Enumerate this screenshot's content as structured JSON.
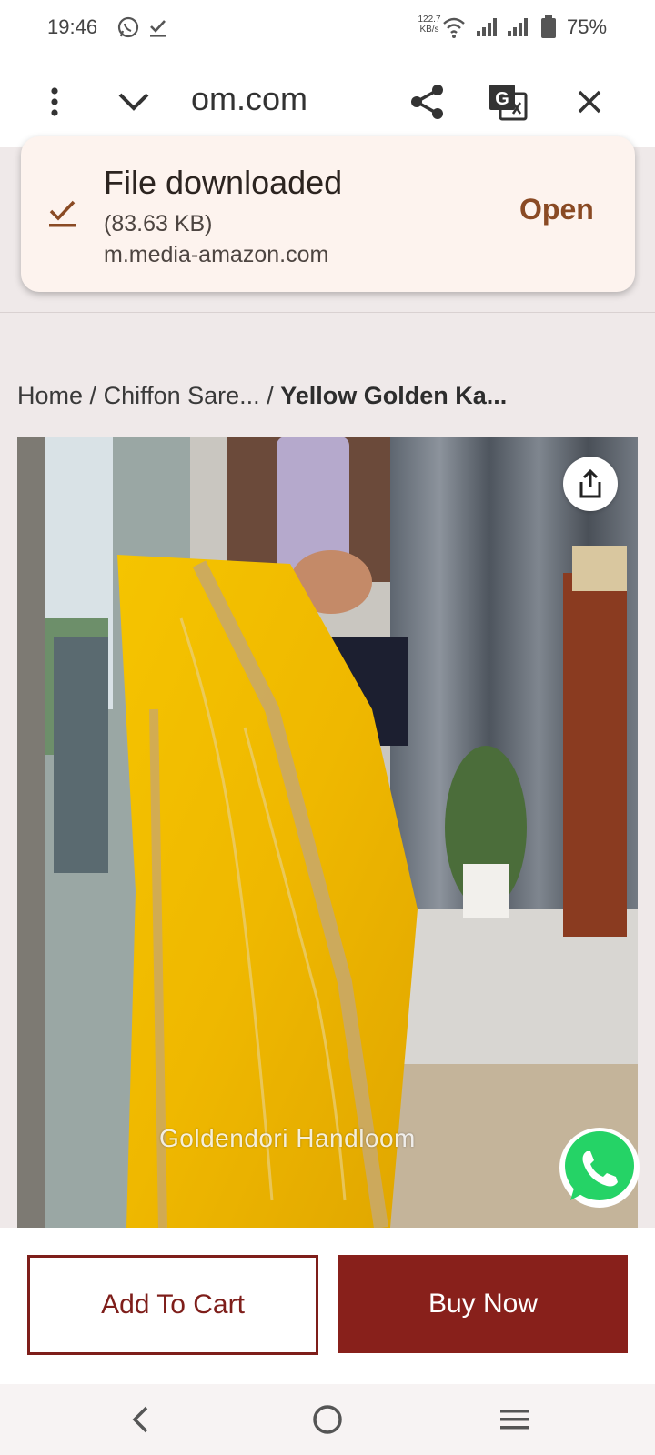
{
  "status_bar": {
    "time": "19:46",
    "speed_value": "122.7",
    "speed_unit": "KB/s",
    "battery": "75%",
    "icons": [
      "whatsapp-icon",
      "download-done-icon",
      "wifi-icon",
      "signal-icon",
      "signal-icon",
      "battery-icon"
    ]
  },
  "toolbar": {
    "url": "om.com",
    "icons": [
      "more-vert-icon",
      "chevron-down-icon",
      "share-icon",
      "translate-icon",
      "close-icon"
    ]
  },
  "toast": {
    "title": "File downloaded",
    "size": "(83.63 KB)",
    "domain": "m.media-amazon.com",
    "action": "Open",
    "accent_color": "#8a4a24"
  },
  "breadcrumb": {
    "items": [
      "Home",
      "Chiffon Sare...",
      "Yellow Golden Ka..."
    ],
    "separator": "/"
  },
  "product": {
    "watermark": "Goldendori Handloom"
  },
  "buy_bar": {
    "add_to_cart": "Add To Cart",
    "buy_now": "Buy Now",
    "brand_color": "#88201b"
  },
  "nav_bar": {
    "icons": [
      "back-icon",
      "home-icon",
      "menu-icon"
    ]
  }
}
